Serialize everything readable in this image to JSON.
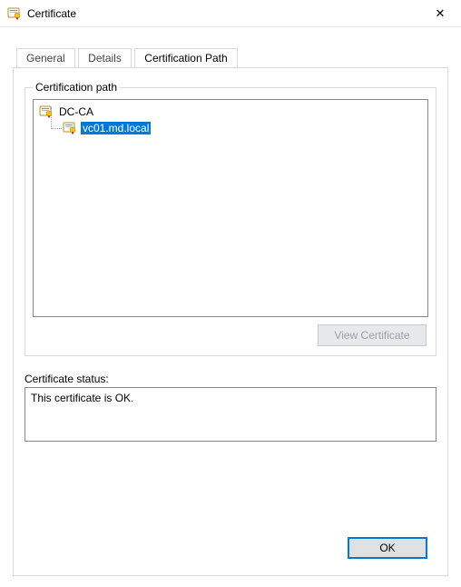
{
  "window": {
    "title": "Certificate"
  },
  "tabs": {
    "general": "General",
    "details": "Details",
    "certpath": "Certification Path"
  },
  "group": {
    "path_label": "Certification path"
  },
  "tree": {
    "root": "DC-CA",
    "child": "vc01.md.local"
  },
  "buttons": {
    "view_cert": "View Certificate",
    "ok": "OK"
  },
  "status": {
    "label": "Certificate status:",
    "value": "This certificate is OK."
  }
}
